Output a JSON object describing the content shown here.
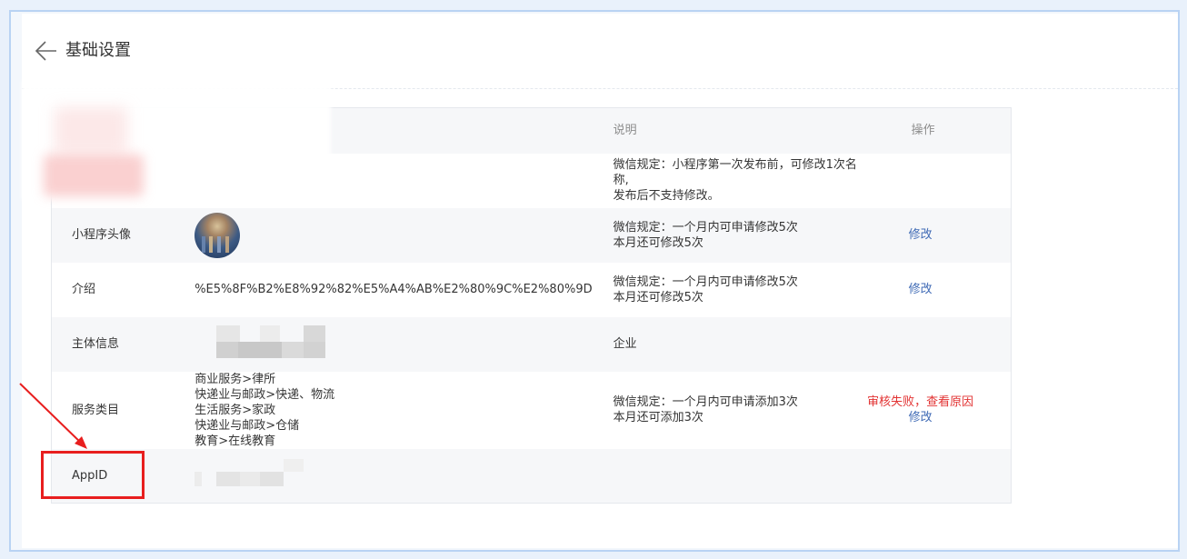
{
  "page": {
    "title": "基础设置"
  },
  "table": {
    "headers": {
      "name": "",
      "value": "",
      "description": "说明",
      "operation": "操作"
    },
    "rows": [
      {
        "name": "",
        "value": "",
        "desc_line1": "微信规定：小程序第一次发布前，可修改1次名称,",
        "desc_line2": "发布后不支持修改。"
      },
      {
        "name": "小程序头像",
        "value_icon": "avatar-image",
        "desc_line1": "微信规定：一个月内可申请修改5次",
        "desc_line2": "本月还可修改5次",
        "op": "修改"
      },
      {
        "name": "介绍",
        "value": "%E5%8F%B2%E8%92%82%E5%A4%AB%E2%80%9C%E2%80%9D",
        "desc_line1": "微信规定：一个月内可申请修改5次",
        "desc_line2": "本月还可修改5次",
        "op": "修改"
      },
      {
        "name": "主体信息",
        "value": "",
        "desc_line1": "企业"
      },
      {
        "name": "服务类目",
        "categories": [
          "商业服务>律所",
          "快递业与邮政>快递、物流",
          "生活服务>家政",
          "快递业与邮政>仓储",
          "教育>在线教育"
        ],
        "desc_line1": "微信规定：一个月内可申请添加3次",
        "desc_line2": "本月还可添加3次",
        "op_warning": "审核失败，查看原因",
        "op": "修改"
      },
      {
        "name": "AppID",
        "value": ""
      }
    ]
  },
  "colors": {
    "link": "#3f6ab5",
    "warning": "#e23232",
    "annotation": "#e81e1e"
  }
}
